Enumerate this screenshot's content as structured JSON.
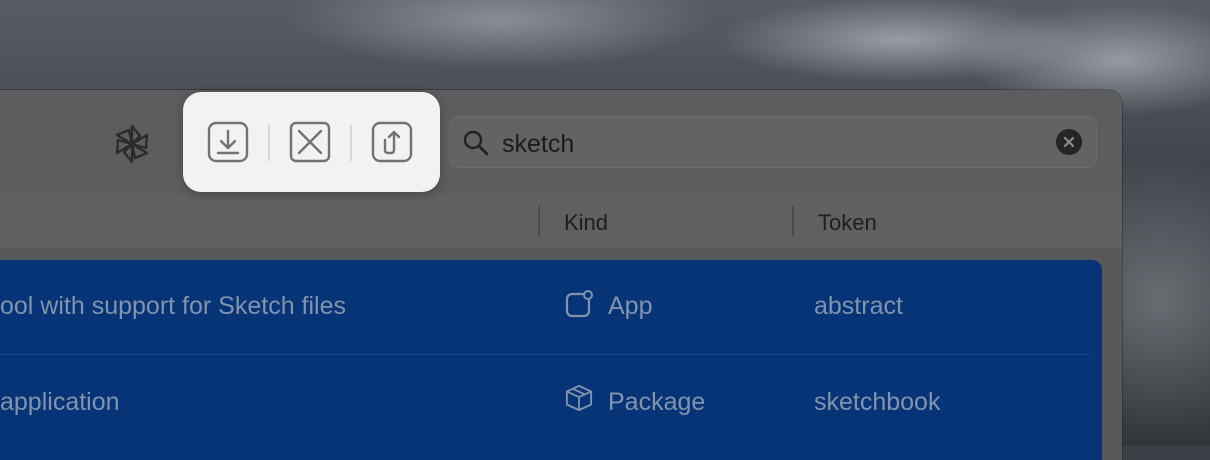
{
  "toolbar": {
    "search": {
      "value": "sketch",
      "placeholder": ""
    }
  },
  "table": {
    "columns": {
      "kind": "Kind",
      "token": "Token"
    },
    "rows": [
      {
        "description": "ool with support for Sketch files",
        "kind": "App",
        "token": "abstract"
      },
      {
        "description": "application",
        "kind": "Package",
        "token": "sketchbook"
      }
    ]
  },
  "icons": {
    "spotlight": "pinwheel-icon",
    "install": "download-tray-icon",
    "remove": "x-square-icon",
    "upgrade": "arrow-up-square-icon",
    "search": "magnifier-icon",
    "clear": "clear-circle-icon",
    "app_kind": "app-square-icon",
    "package_kind": "package-box-icon"
  },
  "colors": {
    "selection": "#063476",
    "selected_text": "#8193ad",
    "highlight_panel": "#f2f2f2",
    "icon_stroke": "#707274"
  }
}
